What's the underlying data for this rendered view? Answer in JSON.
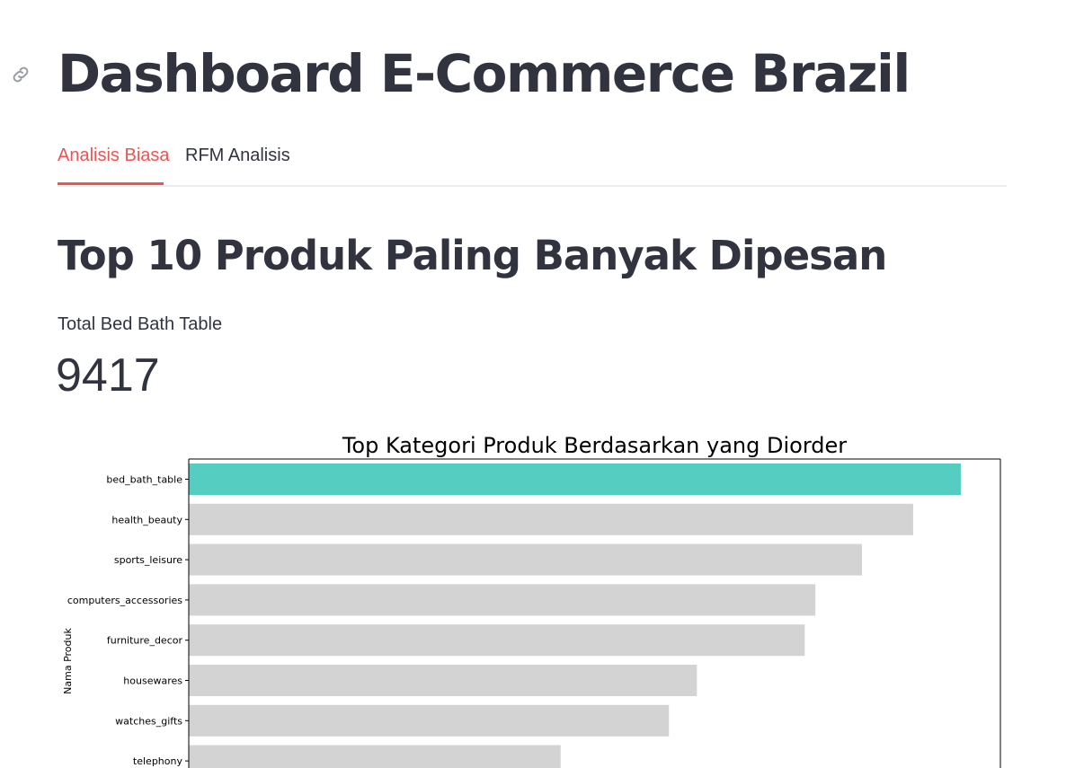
{
  "title": "Dashboard E-Commerce Brazil",
  "tabs": [
    {
      "label": "Analisis Biasa",
      "active": true
    },
    {
      "label": "RFM Analisis",
      "active": false
    }
  ],
  "section": {
    "heading": "Top 10 Produk Paling Banyak Dipesan",
    "metric_label": "Total Bed Bath Table",
    "metric_value": "9417"
  },
  "colors": {
    "accent": "#ef5350",
    "highlight_bar": "#56cdc1",
    "default_bar": "#d3d3d3",
    "text": "#31333f"
  },
  "icons": {
    "anchor": "link-icon"
  },
  "chart_data": {
    "type": "bar",
    "orientation": "horizontal",
    "title": "Top Kategori Produk Berdasarkan yang Diorder",
    "ylabel": "Nama Produk",
    "xlabel": "",
    "categories": [
      "bed_bath_table",
      "health_beauty",
      "sports_leisure",
      "computers_accessories",
      "furniture_decor",
      "housewares",
      "watches_gifts",
      "telephony"
    ],
    "values": [
      9417,
      8836,
      8212,
      7643,
      7513,
      6198,
      5857,
      4536
    ],
    "highlight_category": "bed_bath_table",
    "xlim": [
      0,
      9900
    ]
  }
}
